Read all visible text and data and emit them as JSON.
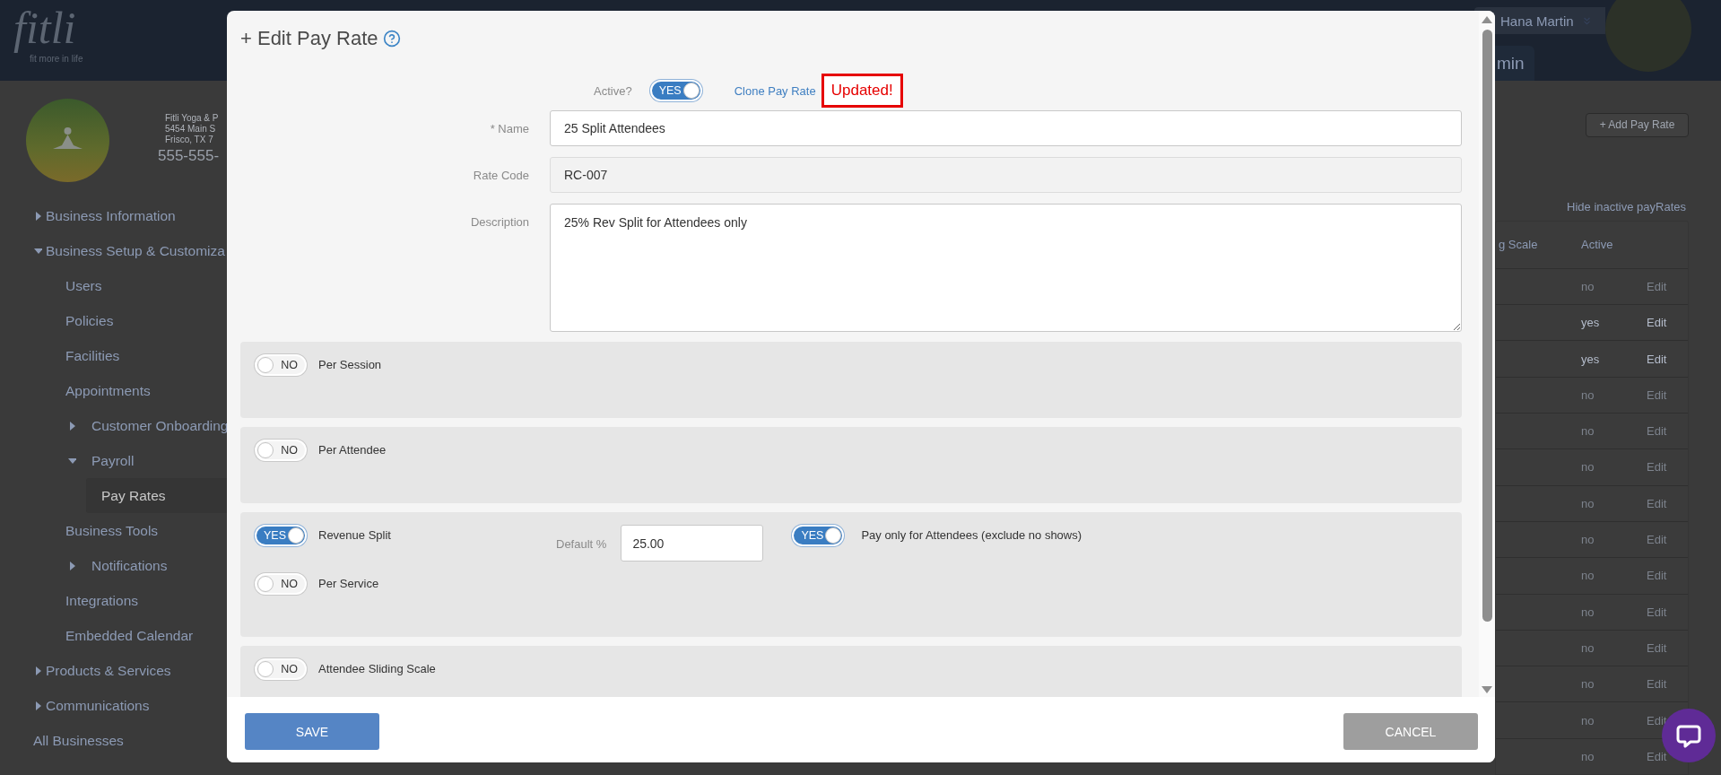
{
  "header": {
    "logo": "fitli",
    "tagline": "fit more in life",
    "user_menu": "Hana Martin",
    "tab": "min"
  },
  "business": {
    "lines": [
      "Fitli Yoga & P",
      "5454 Main S",
      "Frisco, TX 7"
    ],
    "phone": "555-555-"
  },
  "sidebar": {
    "items": [
      {
        "label": "Business Information",
        "expanded": false,
        "selected": false
      },
      {
        "label": "Business Setup & Customiza",
        "expanded": true,
        "selected": false,
        "children": [
          {
            "label": "Users",
            "selected": false
          },
          {
            "label": "Policies",
            "selected": false
          },
          {
            "label": "Facilities",
            "selected": false
          },
          {
            "label": "Appointments",
            "selected": false
          },
          {
            "label": "Customer Onboarding",
            "expanded": false,
            "selected": false
          },
          {
            "label": "Payroll",
            "expanded": true,
            "selected": false,
            "children": [
              {
                "label": "Pay Rates",
                "selected": true
              }
            ]
          },
          {
            "label": "Business Tools",
            "selected": false
          },
          {
            "label": "Notifications",
            "expanded": false,
            "selected": false
          },
          {
            "label": "Integrations",
            "selected": false
          },
          {
            "label": "Embedded Calendar",
            "selected": false
          }
        ]
      },
      {
        "label": "Products & Services",
        "expanded": false,
        "selected": false
      },
      {
        "label": "Communications",
        "expanded": false,
        "selected": false
      },
      {
        "label": "All Businesses",
        "selected": false
      }
    ]
  },
  "main": {
    "add_button": "+ Add Pay Rate",
    "filter_link": "Hide inactive payRates",
    "table": {
      "columns": [
        "g Scale",
        "Active"
      ],
      "rows": [
        {
          "active": "no",
          "action": "Edit",
          "dimmed": true
        },
        {
          "active": "yes",
          "action": "Edit",
          "dimmed": false
        },
        {
          "active": "yes",
          "action": "Edit",
          "dimmed": false
        },
        {
          "active": "no",
          "action": "Edit",
          "dimmed": true
        },
        {
          "active": "no",
          "action": "Edit",
          "dimmed": true
        },
        {
          "active": "no",
          "action": "Edit",
          "dimmed": true
        },
        {
          "active": "no",
          "action": "Edit",
          "dimmed": true
        },
        {
          "active": "no",
          "action": "Edit",
          "dimmed": true
        },
        {
          "active": "no",
          "action": "Edit",
          "dimmed": true
        },
        {
          "active": "no",
          "action": "Edit",
          "dimmed": true
        },
        {
          "active": "no",
          "action": "Edit",
          "dimmed": true
        },
        {
          "active": "no",
          "action": "Edit",
          "dimmed": true
        },
        {
          "active": "no",
          "action": "Edit",
          "dimmed": true
        },
        {
          "active": "no",
          "action": "Edit",
          "dimmed": true
        }
      ]
    }
  },
  "modal": {
    "title": "+ Edit Pay Rate",
    "active_label": "Active?",
    "active_toggle": {
      "text": "YES",
      "on": true
    },
    "clone_link": "Clone Pay Rate",
    "status": "Updated!",
    "fields": [
      {
        "label": "* Name",
        "value": "25 Split Attendees",
        "kind": "text"
      },
      {
        "label": "Rate Code",
        "value": "RC-007",
        "kind": "readonly"
      },
      {
        "label": "Description",
        "value": "25% Rev Split for Attendees only",
        "kind": "textarea"
      }
    ],
    "sections": [
      {
        "options": [
          {
            "toggle": {
              "text": "NO",
              "on": false
            },
            "label": "Per Session"
          }
        ]
      },
      {
        "options": [
          {
            "toggle": {
              "text": "NO",
              "on": false
            },
            "label": "Per Attendee"
          }
        ]
      },
      {
        "options": [
          {
            "toggle": {
              "text": "YES",
              "on": true
            },
            "label": "Revenue Split",
            "default_label": "Default %",
            "default_value": "25.00",
            "sub_toggle": {
              "text": "YES",
              "on": true
            },
            "sub_label": "Pay only for Attendees (exclude no shows)"
          },
          {
            "toggle": {
              "text": "NO",
              "on": false
            },
            "label": "Per Service"
          }
        ]
      },
      {
        "options": [
          {
            "toggle": {
              "text": "NO",
              "on": false
            },
            "label": "Attendee Sliding Scale"
          }
        ]
      }
    ],
    "buttons": [
      {
        "label": "SAVE",
        "kind": "primary"
      },
      {
        "label": "CANCEL",
        "kind": "secondary"
      }
    ]
  }
}
